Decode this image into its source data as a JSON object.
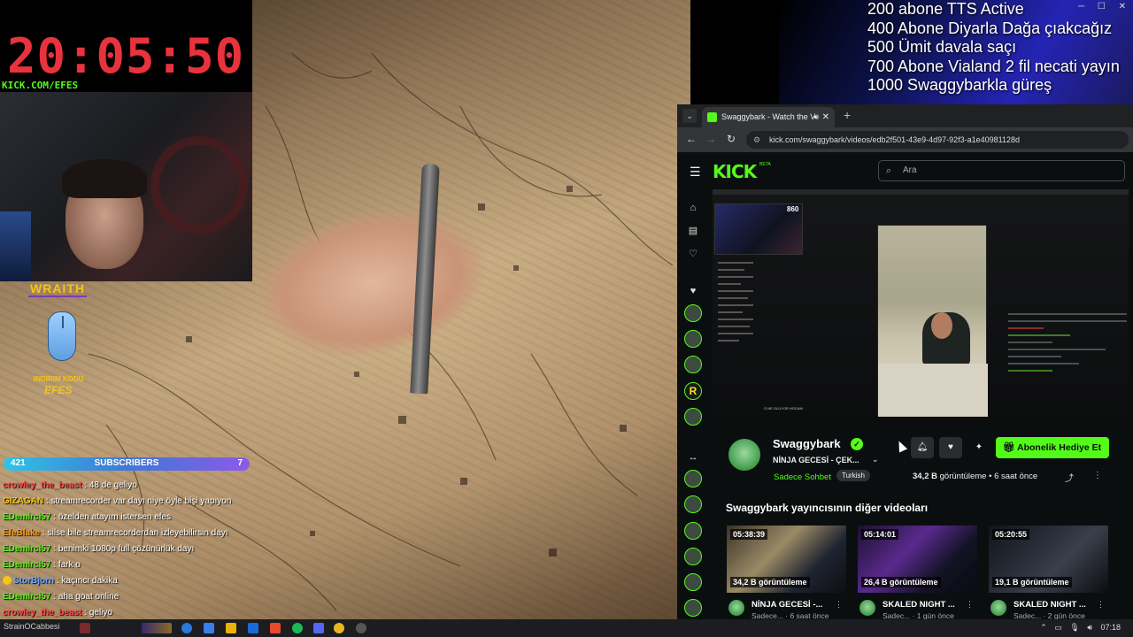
{
  "timer": {
    "time": "20:05:50",
    "url": "KICK.COM/EFES"
  },
  "sponsor": {
    "brand": "WRAITH",
    "code_label": "INDIRIM KODU",
    "code": "EFES"
  },
  "subscribers": {
    "current": "421",
    "label": "SUBSCRIBERS",
    "goal": "7"
  },
  "stream_chat": [
    {
      "user": "crowley_the_beast",
      "message": "48 de geliyo",
      "color": "#ff4a4a"
    },
    {
      "user": "GIZAGAN",
      "message": "streamrecorder var dayı niye öyle bişi yapıyon",
      "color": "#f5c518"
    },
    {
      "user": "EDemirci57",
      "message": "özelden atayım istersen efes",
      "color": "#53fc18"
    },
    {
      "user": "EfeBlake",
      "message": "silse bile streamrecorderdan izleyebilirsin dayı",
      "color": "#ff9f1a"
    },
    {
      "user": "EDemirci57",
      "message": "benimki 1080p full çözünürlük dayı",
      "color": "#53fc18"
    },
    {
      "user": "EDemirci57",
      "message": "fark o",
      "color": "#53fc18"
    },
    {
      "user": "StorBjorn",
      "message": "kaçıncı dakika",
      "color": "#6fa8ff",
      "badge": true
    },
    {
      "user": "EDemirci57",
      "message": "aha goat online",
      "color": "#53fc18"
    },
    {
      "user": "crowley_the_beast",
      "message": "geliyo",
      "color": "#ff4a4a"
    }
  ],
  "goals": [
    "200 abone TTS Active",
    "400 Abone Diyarla Dağa çıakcağız",
    "500 Ümit davala saçı",
    "700 Abone Vialand 2 fil necati yayın",
    "1000 Swaggybarkla güreş"
  ],
  "browser": {
    "tab_title": "Swaggybark - Watch the V",
    "url": "kick.com/swaggybark/videos/edb2f501-43e9-4d97-92f3-a1e40981128d"
  },
  "kick": {
    "logo": "KICK",
    "beta": "BETA",
    "search_placeholder": "Ara",
    "player_viewer_count": "860",
    "player_caption": "O NE OLUYOR HOCAM",
    "channel": {
      "name": "Swaggybark",
      "title": "NİNJA GECESİ - ÇEK...",
      "category": "Sadece Sohbet",
      "language": "Turkish",
      "views": "34,2 B",
      "views_suffix": "görüntüleme",
      "age": "6 saat önce",
      "gift_button": "Abonelik Hediye Et"
    },
    "more_heading": "Swaggybark yayıncısının diğer videoları",
    "videos": [
      {
        "duration": "05:38:39",
        "views": "34,2 B görüntüleme",
        "title": "NİNJA GECESİ -...",
        "sub": "Sadece... · 6 saat önce"
      },
      {
        "duration": "05:14:01",
        "views": "26,4 B görüntüleme",
        "title": "SKALED NIGHT ...",
        "sub": "Sadec... · 1 gün önce"
      },
      {
        "duration": "05:20:55",
        "views": "19,1 B görüntüleme",
        "title": "SKALED NIGHT ...",
        "sub": "Sadec... · 2 gün önce"
      }
    ]
  },
  "taskbar": {
    "user": "StrainOCabbesi",
    "time": "07:18"
  },
  "colors": {
    "kick_green": "#53fc18",
    "timer_red": "#e8333d"
  }
}
